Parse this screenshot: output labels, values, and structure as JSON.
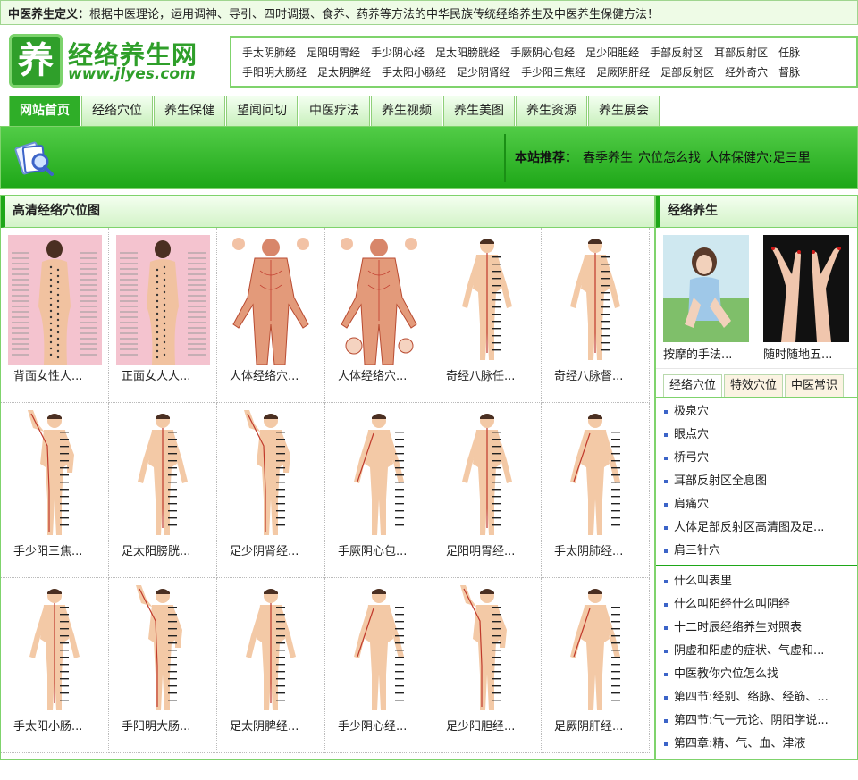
{
  "topbar": {
    "label": "中医养生定义：",
    "text": "根据中医理论，运用调神、导引、四时调摄、食养、药养等方法的中华民族传统经络养生及中医养生保健方法！"
  },
  "logo": {
    "mark": "养",
    "name": "经络养生网",
    "url": "www.jlyes.com"
  },
  "meridians": {
    "row1": [
      "手太阴肺经",
      "足阳明胃经",
      "手少阴心经",
      "足太阳膀胱经",
      "手厥阴心包经",
      "足少阳胆经",
      "手部反射区",
      "耳部反射区",
      "任脉"
    ],
    "row2": [
      "手阳明大肠经",
      "足太阴脾经",
      "手太阳小肠经",
      "足少阴肾经",
      "手少阳三焦经",
      "足厥阴肝经",
      "足部反射区",
      "经外奇穴",
      "督脉"
    ]
  },
  "nav": [
    "网站首页",
    "经络穴位",
    "养生保健",
    "望闻问切",
    "中医疗法",
    "养生视频",
    "养生美图",
    "养生资源",
    "养生展会"
  ],
  "banner": {
    "label": "本站推荐：",
    "links": [
      "春季养生",
      "穴位怎么找",
      "人体保健穴:足三里"
    ]
  },
  "main": {
    "title": "高清经络穴位图",
    "cells": [
      {
        "caption": "背面女性人...",
        "kind": "photo-back"
      },
      {
        "caption": "正面女人人...",
        "kind": "photo-front"
      },
      {
        "caption": "人体经络穴...",
        "kind": "anatomy-back"
      },
      {
        "caption": "人体经络穴...",
        "kind": "anatomy-front"
      },
      {
        "caption": "奇经八脉任...",
        "kind": "front-line"
      },
      {
        "caption": "奇经八脉督...",
        "kind": "back-line"
      },
      {
        "caption": "手少阳三焦...",
        "kind": "side-arm"
      },
      {
        "caption": "足太阳膀胱...",
        "kind": "back-line"
      },
      {
        "caption": "足少阴肾经...",
        "kind": "side-arm"
      },
      {
        "caption": "手厥阴心包...",
        "kind": "front"
      },
      {
        "caption": "足阳明胃经...",
        "kind": "front-line"
      },
      {
        "caption": "手太阴肺经...",
        "kind": "front"
      },
      {
        "caption": "手太阳小肠...",
        "kind": "back-line"
      },
      {
        "caption": "手阳明大肠...",
        "kind": "side-arm"
      },
      {
        "caption": "足太阴脾经...",
        "kind": "front-line"
      },
      {
        "caption": "手少阴心经...",
        "kind": "front"
      },
      {
        "caption": "足少阳胆经...",
        "kind": "side-arm"
      },
      {
        "caption": "足厥阴肝经...",
        "kind": "front"
      }
    ]
  },
  "side": {
    "title": "经络养生",
    "photos": [
      "按摩的手法...",
      "随时随地五..."
    ],
    "tabs": [
      "经络穴位",
      "特效穴位",
      "中医常识"
    ],
    "list1": [
      "极泉穴",
      "眼点穴",
      "桥弓穴",
      "耳部反射区全息图",
      "肩痛穴",
      "人体足部反射区高清图及足...",
      "肩三针穴"
    ],
    "list2": [
      "什么叫表里",
      "什么叫阳经什么叫阴经",
      "十二时辰经络养生对照表",
      "阴虚和阳虚的症状、气虚和...",
      "中医教你穴位怎么找",
      "第四节:经别、络脉、经筋、...",
      "第四节:气一元论、阴阳学说...",
      "第四章:精、气、血、津液"
    ]
  },
  "colors": {
    "brand": "#1ea718",
    "border": "#7fd36c",
    "link-bullet": "#3c64c8"
  }
}
